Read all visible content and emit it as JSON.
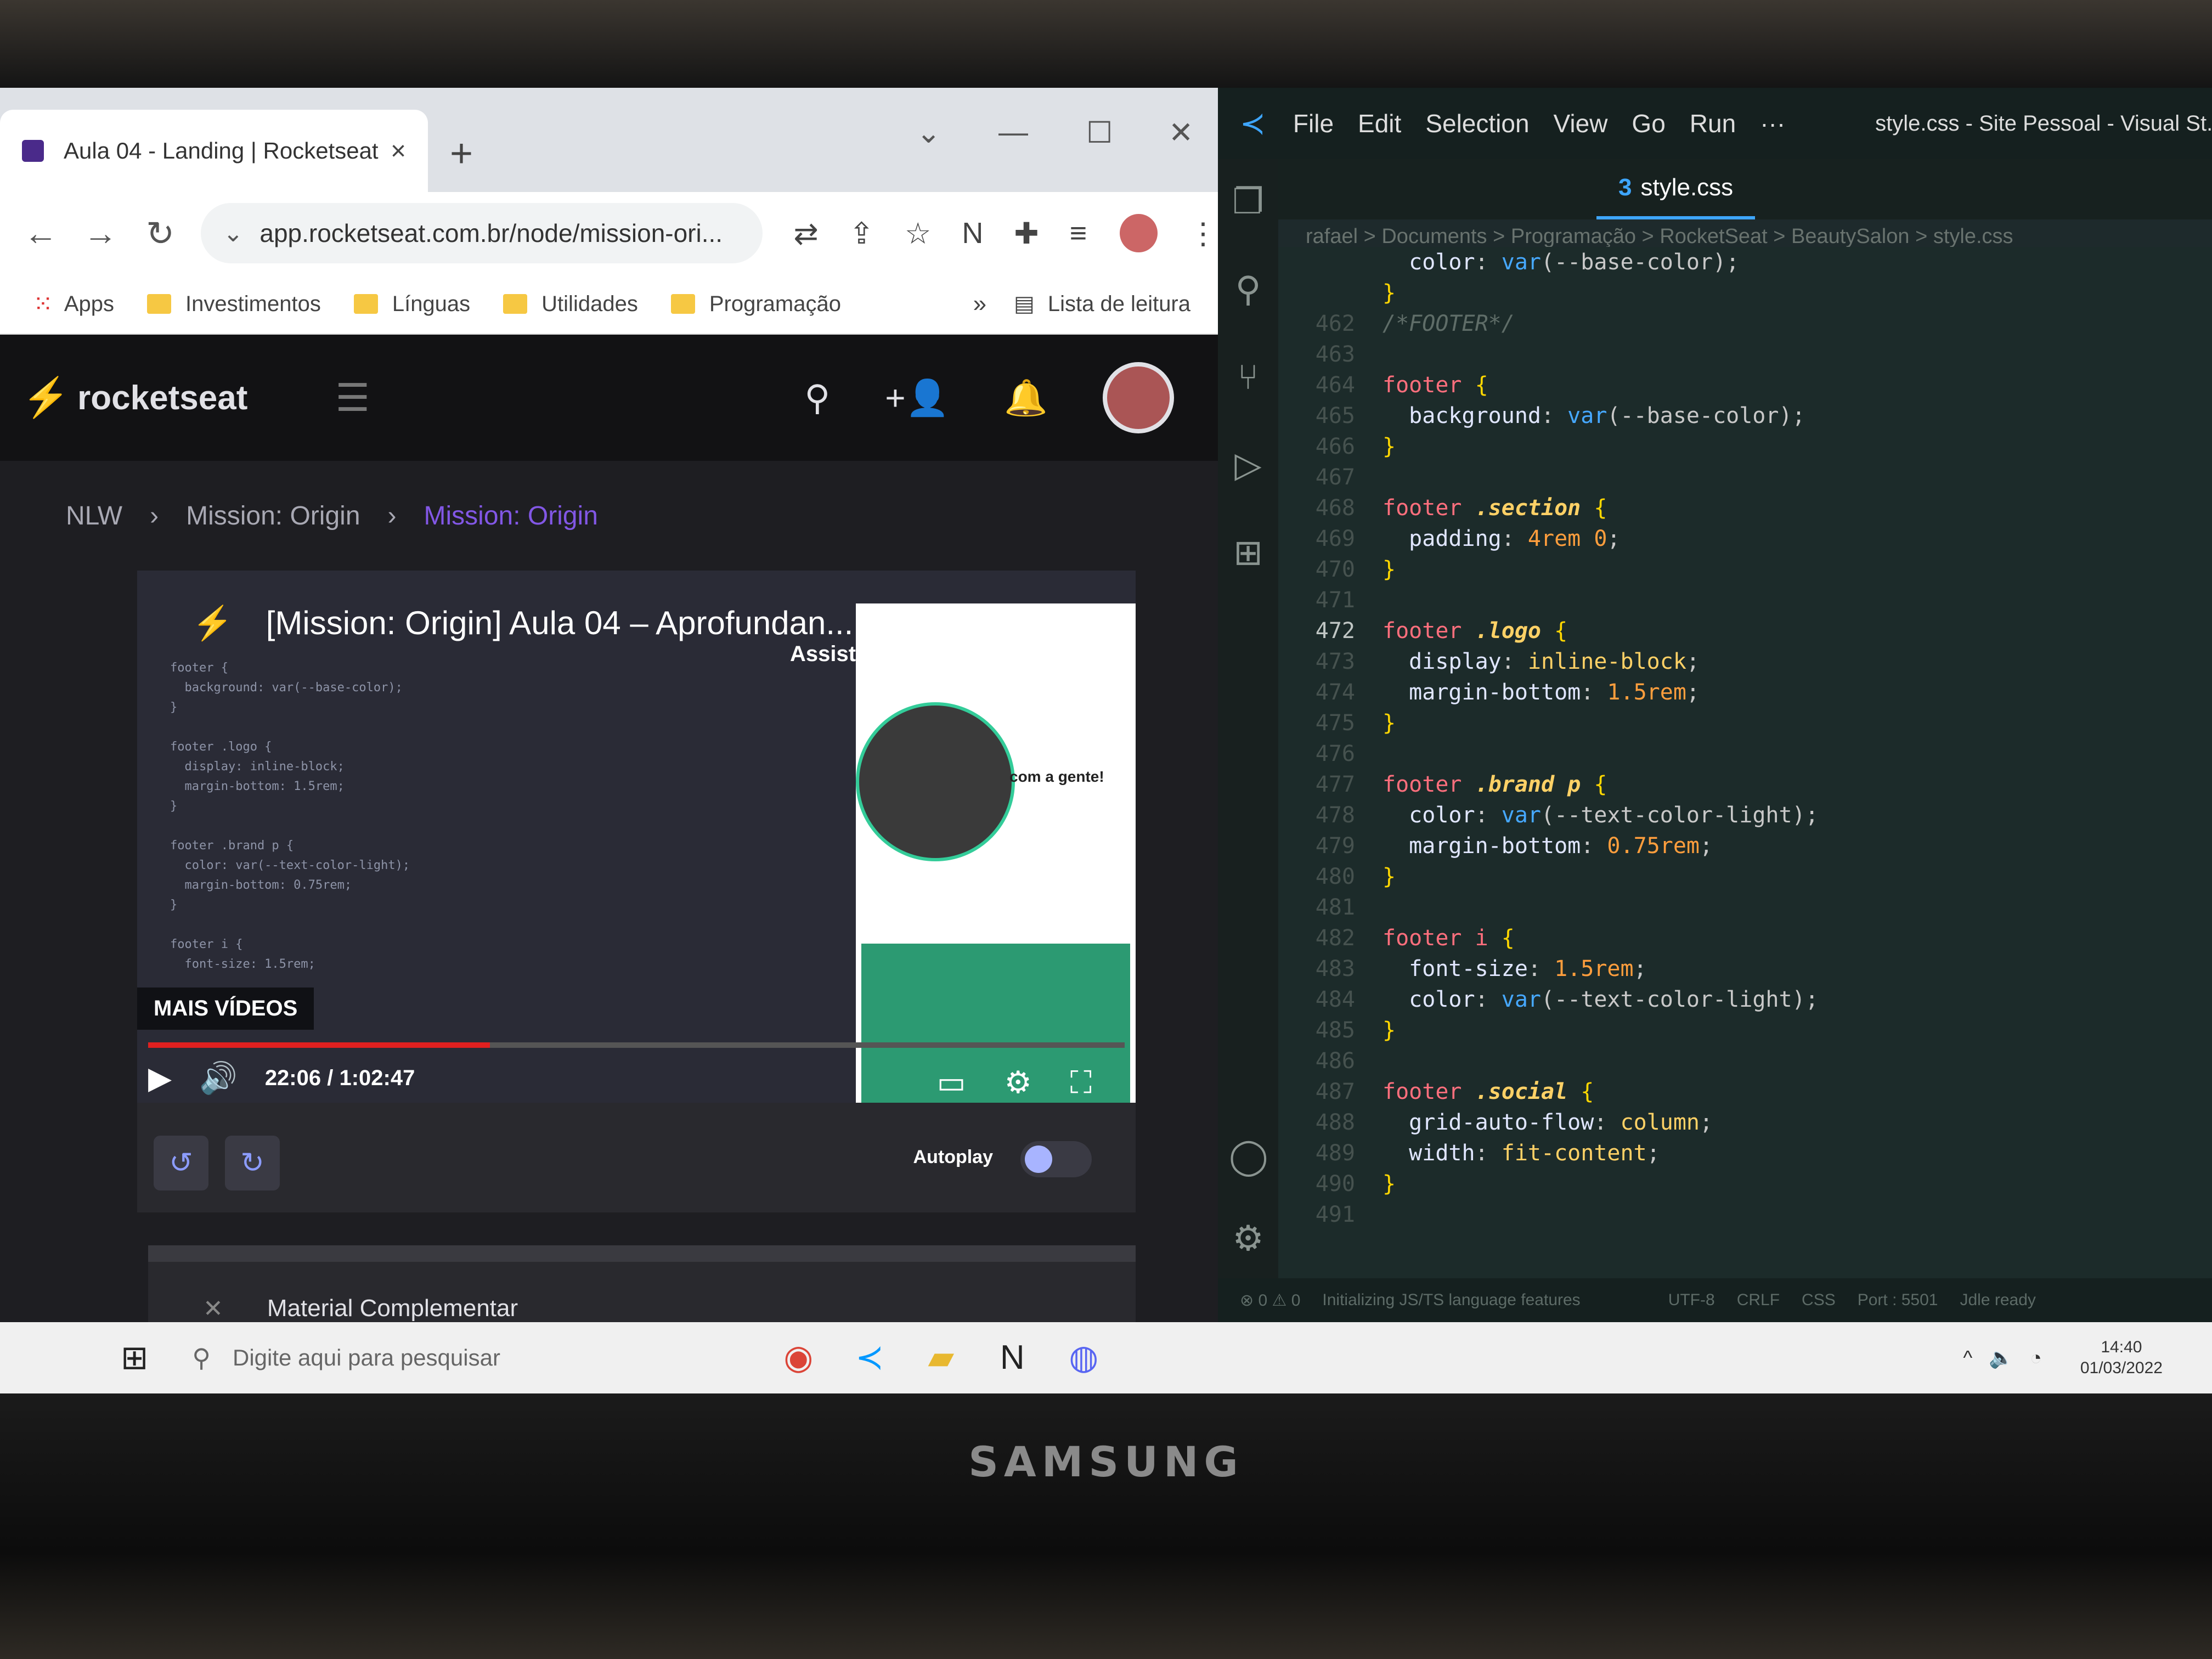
{
  "chrome": {
    "tab_title": "Aula 04 - Landing | Rocketseat",
    "tab_close": "×",
    "new_tab": "+",
    "url": "app.rocketseat.com.br/node/mission-ori...",
    "bookmarks": [
      "Investimentos",
      "Línguas",
      "Utilidades",
      "Programação"
    ],
    "apps_label": "Apps",
    "bookmarks_more": "»",
    "reading_list": "Lista de leitura"
  },
  "rocketseat": {
    "logo": "rocketseat",
    "breadcrumb": [
      "NLW",
      "Mission: Origin",
      "Mission: Origin"
    ],
    "video_title": "[Mission: Origin] Aula 04 – Aprofundan...",
    "video_overlay_actions": "Assistir mais  Compartilhar",
    "phone_text": "com a gente!",
    "mais_videos": "MAIS VÍDEOS",
    "time": "22:06 / 1:02:47",
    "progress_fraction": 0.35,
    "autoplay_label": "Autoplay",
    "autoplay_on": true,
    "material": "Material Complementar"
  },
  "vscode": {
    "menu": [
      "File",
      "Edit",
      "Selection",
      "View",
      "Go",
      "Run",
      "···"
    ],
    "window_title": "style.css - Site Pessoal - Visual St...",
    "tab": "style.css",
    "breadcrumb": "rafael > Documents > Programação > RocketSeat > BeautySalon > style.css",
    "code_lines": [
      {
        "n": "",
        "html": "<span class='tok-prop'>  color</span><span class='tok-p'>: </span><span class='tok-fn'>var</span><span class='tok-p'>(--base-color);</span>"
      },
      {
        "n": "",
        "html": "<span class='tok-brace'>}</span>"
      },
      {
        "n": "462",
        "html": "<span class='tok-com'>/*FOOTER*/</span>"
      },
      {
        "n": "463",
        "html": ""
      },
      {
        "n": "464",
        "html": "<span class='tok-sel'>footer</span><span class='tok-brace'> {</span>"
      },
      {
        "n": "465",
        "html": "<span class='tok-prop'>  background</span><span class='tok-p'>: </span><span class='tok-fn'>var</span><span class='tok-p'>(--base-color);</span>"
      },
      {
        "n": "466",
        "html": "<span class='tok-brace'>}</span>"
      },
      {
        "n": "467",
        "html": ""
      },
      {
        "n": "468",
        "html": "<span class='tok-sel'>footer</span><span class='tok-cls'> .section</span><span class='tok-brace'> {</span>"
      },
      {
        "n": "469",
        "html": "<span class='tok-prop'>  padding</span><span class='tok-p'>: </span><span class='tok-num'>4rem 0</span><span class='tok-p'>;</span>"
      },
      {
        "n": "470",
        "html": "<span class='tok-brace'>}</span>"
      },
      {
        "n": "471",
        "html": ""
      },
      {
        "n": "472",
        "cur": true,
        "html": "<span class='tok-sel'>footer</span><span class='tok-cls'> .logo</span><span class='tok-brace'> {</span>"
      },
      {
        "n": "473",
        "html": "<span class='tok-prop'>  display</span><span class='tok-p'>: </span><span class='tok-kw'>inline-block</span><span class='tok-p'>;</span>"
      },
      {
        "n": "474",
        "html": "<span class='tok-prop'>  margin-bottom</span><span class='tok-p'>: </span><span class='tok-num'>1.5rem</span><span class='tok-p'>;</span>"
      },
      {
        "n": "475",
        "html": "<span class='tok-brace'>}</span>"
      },
      {
        "n": "476",
        "html": ""
      },
      {
        "n": "477",
        "html": "<span class='tok-sel'>footer</span><span class='tok-cls'> .brand</span><span class='tok-cls'> p</span><span class='tok-brace'> {</span>"
      },
      {
        "n": "478",
        "html": "<span class='tok-prop'>  color</span><span class='tok-p'>: </span><span class='tok-fn'>var</span><span class='tok-p'>(--text-color-light);</span>"
      },
      {
        "n": "479",
        "html": "<span class='tok-prop'>  margin-bottom</span><span class='tok-p'>: </span><span class='tok-num'>0.75rem</span><span class='tok-p'>;</span>"
      },
      {
        "n": "480",
        "html": "<span class='tok-brace'>}</span>"
      },
      {
        "n": "481",
        "html": ""
      },
      {
        "n": "482",
        "html": "<span class='tok-sel'>footer</span><span class='tok-sel'> i</span><span class='tok-brace'> {</span>"
      },
      {
        "n": "483",
        "html": "<span class='tok-prop'>  font-size</span><span class='tok-p'>: </span><span class='tok-num'>1.5rem</span><span class='tok-p'>;</span>"
      },
      {
        "n": "484",
        "html": "<span class='tok-prop'>  color</span><span class='tok-p'>: </span><span class='tok-fn'>var</span><span class='tok-p'>(--text-color-light);</span>"
      },
      {
        "n": "485",
        "html": "<span class='tok-brace'>}</span>"
      },
      {
        "n": "486",
        "html": ""
      },
      {
        "n": "487",
        "html": "<span class='tok-sel'>footer</span><span class='tok-cls'> .social</span><span class='tok-brace'> {</span>"
      },
      {
        "n": "488",
        "html": "<span class='tok-prop'>  grid-auto-flow</span><span class='tok-p'>: </span><span class='tok-kw'>column</span><span class='tok-p'>;</span>"
      },
      {
        "n": "489",
        "html": "<span class='tok-prop'>  width</span><span class='tok-p'>: </span><span class='tok-kw'>fit-content</span><span class='tok-p'>;</span>"
      },
      {
        "n": "490",
        "html": "<span class='tok-brace'>}</span>"
      },
      {
        "n": "491",
        "html": ""
      }
    ],
    "status": {
      "problems": "⊗ 0  ⚠ 0",
      "init": "Initializing JS/TS language features",
      "encoding": "UTF-8",
      "eol": "CRLF",
      "lang": "CSS",
      "port": "Port : 5501",
      "idle": "Jdle ready"
    }
  },
  "taskbar": {
    "search_placeholder": "Digite aqui para pesquisar",
    "time": "14:40",
    "date": "01/03/2022"
  },
  "device_brand": "SAMSUNG",
  "colors": {
    "rocketseat_purple": "#8257e5",
    "vscode_blue": "#3ea6ff",
    "progress_red": "#e02020"
  }
}
